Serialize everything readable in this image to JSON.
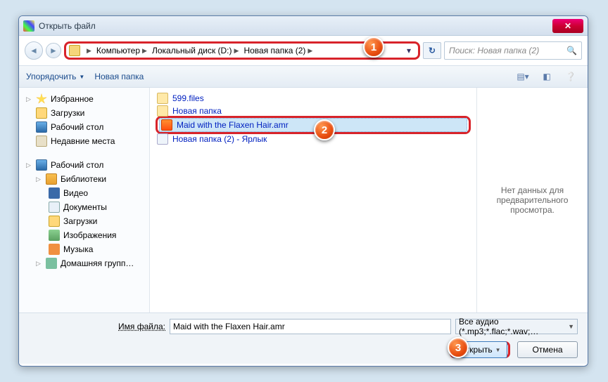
{
  "window": {
    "title": "Открыть файл"
  },
  "breadcrumb": {
    "items": [
      "Компьютер",
      "Локальный диск (D:)",
      "Новая папка (2)"
    ]
  },
  "search": {
    "placeholder": "Поиск: Новая папка (2)"
  },
  "toolbar": {
    "organize": "Упорядочить",
    "newfolder": "Новая папка"
  },
  "tree": {
    "favorites": "Избранное",
    "downloads": "Загрузки",
    "desktop": "Рабочий стол",
    "recent": "Недавние места",
    "desktop2": "Рабочий стол",
    "libraries": "Библиотеки",
    "video": "Видео",
    "documents": "Документы",
    "downloads2": "Загрузки",
    "pictures": "Изображения",
    "music": "Музыка",
    "homegroup": "Домашняя групп…"
  },
  "files": {
    "f0": "599.files",
    "f1": "Новая папка",
    "f2": "Maid with the Flaxen Hair.amr",
    "f3": "Новая папка (2) - Ярлык"
  },
  "preview": {
    "empty": "Нет данных для предварительного просмотра."
  },
  "footer": {
    "filename_label": "Имя файла:",
    "filename_value": "Maid with the Flaxen Hair.amr",
    "filter": "Все аудио (*.mp3;*.flac;*.wav;…",
    "open": "Открыть",
    "cancel": "Отмена"
  },
  "callouts": {
    "c1": "1",
    "c2": "2",
    "c3": "3"
  }
}
